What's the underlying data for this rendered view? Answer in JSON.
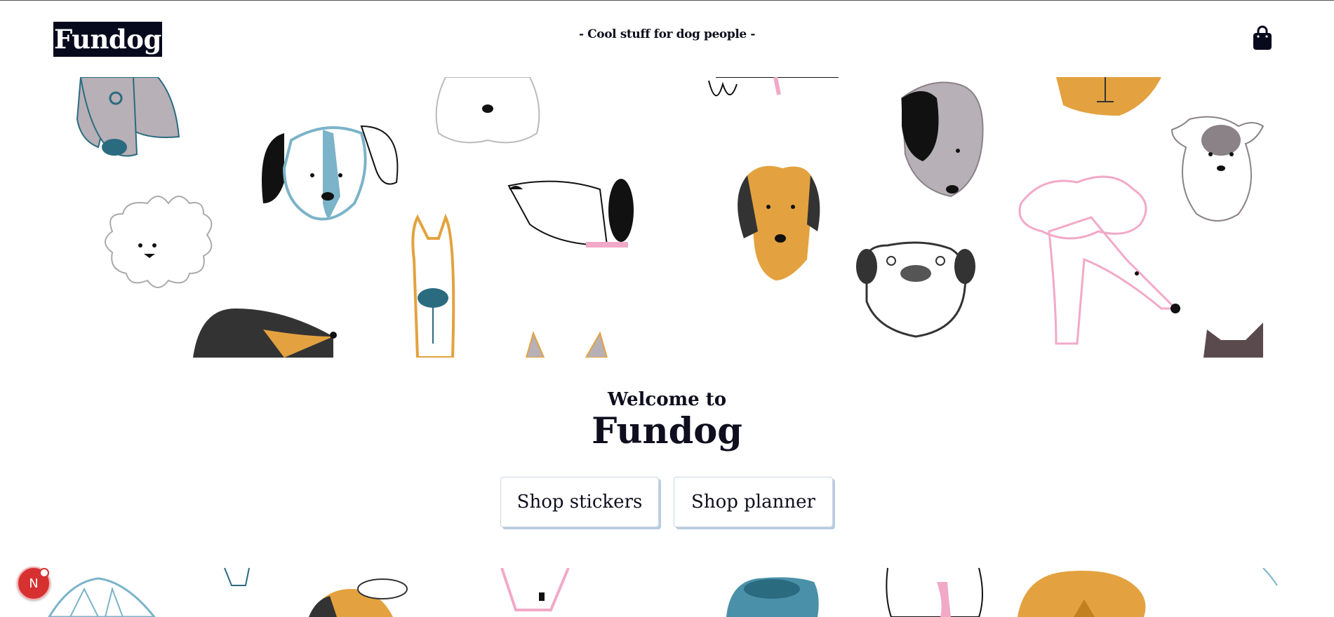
{
  "header": {
    "logo_text": "Fundog",
    "tagline": "- Cool stuff for dog people -",
    "cart_icon": "shopping-bag-icon"
  },
  "hero": {
    "welcome_line": "Welcome to",
    "brand_name": "Fundog"
  },
  "actions": {
    "shop_stickers_label": "Shop stickers",
    "shop_planner_label": "Shop planner"
  },
  "dev_badge": {
    "letter": "N"
  },
  "colors": {
    "navy": "#07091d",
    "button_shadow": "#b9cce0",
    "dog_blue": "#7bb3c9",
    "dog_teal": "#2a6b80",
    "dog_orange": "#e3a23f",
    "dog_pink": "#f2a9c8",
    "dog_grey": "#b7b0b6",
    "badge_red": "#d63031"
  }
}
